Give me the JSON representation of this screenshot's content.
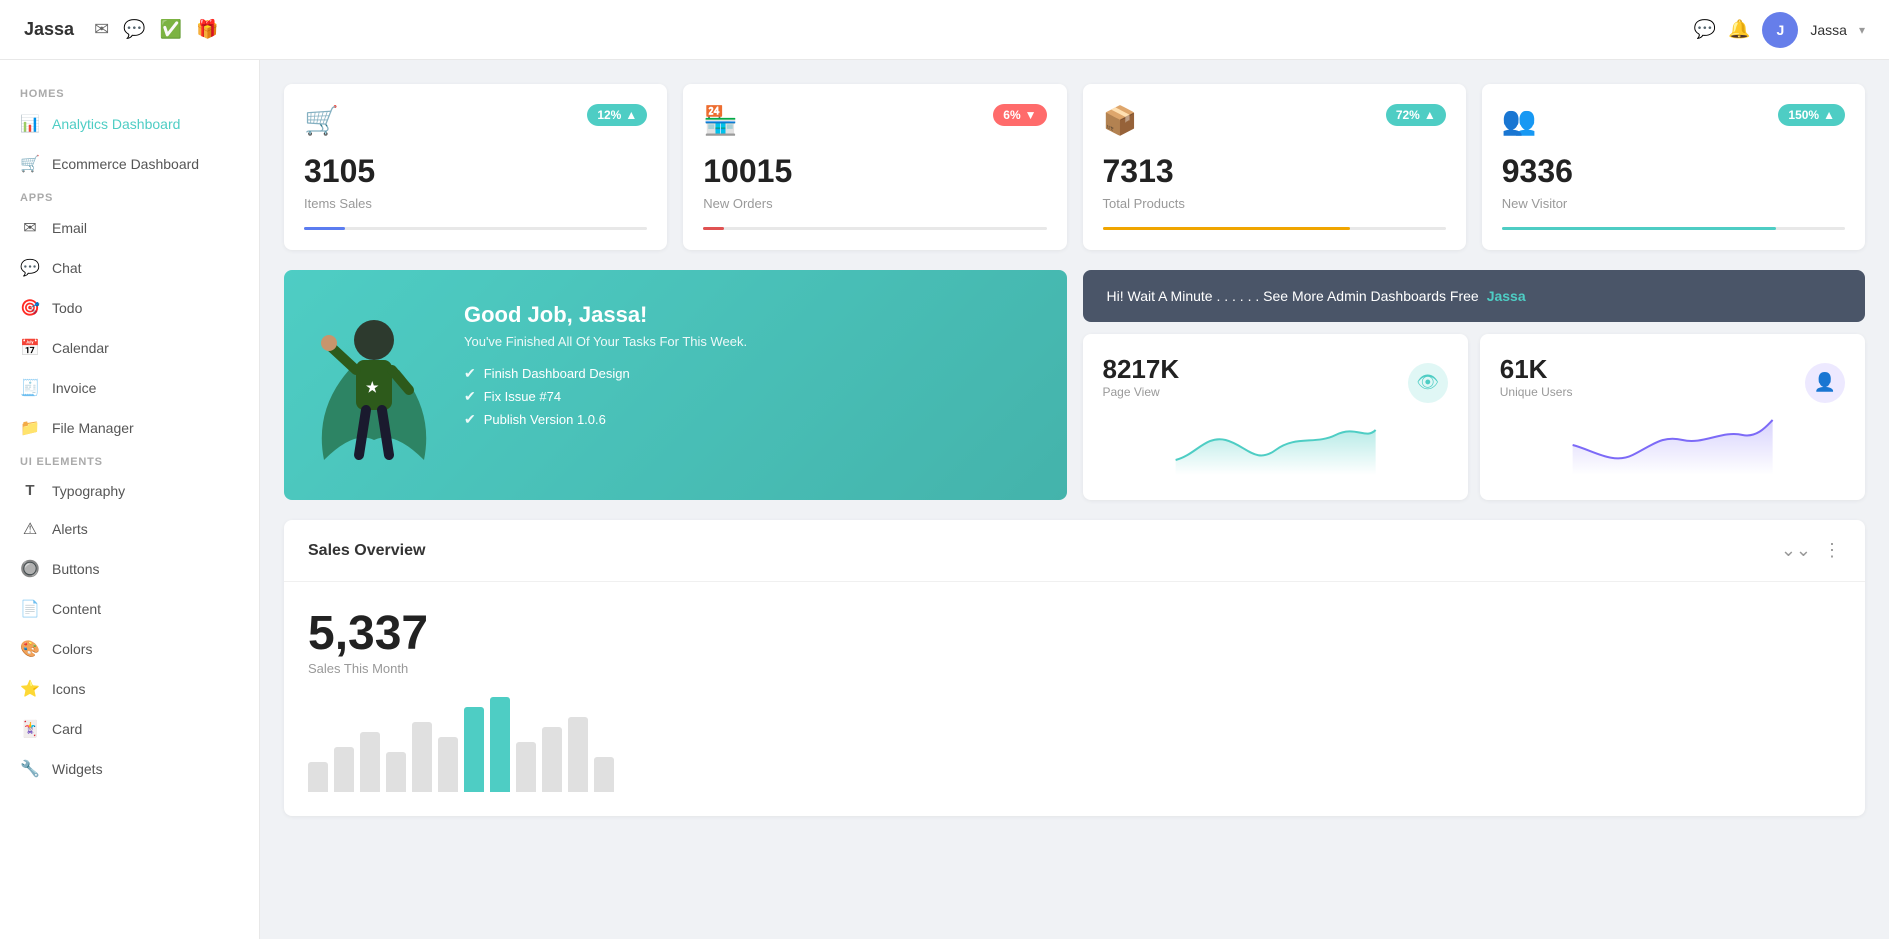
{
  "brand": "Jassa",
  "topnav": {
    "icons": [
      "✉",
      "💬",
      "✅",
      "🎁"
    ],
    "right_icons": [
      "💬",
      "🔔"
    ],
    "user": {
      "name": "Jassa",
      "avatar_initial": "J"
    }
  },
  "sidebar": {
    "sections": [
      {
        "label": "HOMES",
        "items": [
          {
            "id": "analytics-dashboard",
            "label": "Analytics Dashboard",
            "icon": "📊",
            "active": true
          },
          {
            "id": "ecommerce-dashboard",
            "label": "Ecommerce Dashboard",
            "icon": "🛒",
            "active": false
          }
        ]
      },
      {
        "label": "APPS",
        "items": [
          {
            "id": "email",
            "label": "Email",
            "icon": "✉",
            "active": false
          },
          {
            "id": "chat",
            "label": "Chat",
            "icon": "💬",
            "active": false
          },
          {
            "id": "todo",
            "label": "Todo",
            "icon": "🎯",
            "active": false
          },
          {
            "id": "calendar",
            "label": "Calendar",
            "icon": "📅",
            "active": false
          },
          {
            "id": "invoice",
            "label": "Invoice",
            "icon": "🧾",
            "active": false
          },
          {
            "id": "file-manager",
            "label": "File Manager",
            "icon": "📁",
            "active": false
          }
        ]
      },
      {
        "label": "UI ELEMENTS",
        "items": [
          {
            "id": "typography",
            "label": "Typography",
            "icon": "T",
            "active": false
          },
          {
            "id": "alerts",
            "label": "Alerts",
            "icon": "⚠",
            "active": false
          },
          {
            "id": "buttons",
            "label": "Buttons",
            "icon": "🔘",
            "active": false
          },
          {
            "id": "content",
            "label": "Content",
            "icon": "📄",
            "active": false
          },
          {
            "id": "colors",
            "label": "Colors",
            "icon": "🎨",
            "active": false
          },
          {
            "id": "icons",
            "label": "Icons",
            "icon": "⭐",
            "active": false
          },
          {
            "id": "card",
            "label": "Card",
            "icon": "🃏",
            "active": false
          },
          {
            "id": "widgets",
            "label": "Widgets",
            "icon": "🔧",
            "active": false
          }
        ]
      }
    ]
  },
  "stat_cards": [
    {
      "id": "items-sales",
      "icon": "🛒",
      "icon_color": "#5b7cf0",
      "badge_text": "12%",
      "badge_direction": "up",
      "value": "3105",
      "label": "Items Sales",
      "progress": 12,
      "progress_color": "#5b7cf0"
    },
    {
      "id": "new-orders",
      "icon": "🏪",
      "icon_color": "#e05252",
      "badge_text": "6%",
      "badge_direction": "down",
      "value": "10015",
      "label": "New Orders",
      "progress": 6,
      "progress_color": "#e05252"
    },
    {
      "id": "total-products",
      "icon": "📦",
      "icon_color": "#f0a500",
      "badge_text": "72%",
      "badge_direction": "up",
      "value": "7313",
      "label": "Total Products",
      "progress": 72,
      "progress_color": "#f0a500"
    },
    {
      "id": "new-visitor",
      "icon": "👥",
      "icon_color": "#4ecdc4",
      "badge_text": "150%",
      "badge_direction": "up",
      "value": "9336",
      "label": "New Visitor",
      "progress": 80,
      "progress_color": "#4ecdc4"
    }
  ],
  "hero": {
    "title": "Good Job, Jassa!",
    "subtitle": "You've Finished All Of Your Tasks For This Week.",
    "tasks": [
      "Finish Dashboard Design",
      "Fix Issue #74",
      "Publish Version 1.0.6"
    ]
  },
  "announcement": {
    "text": "Hi! Wait A Minute . . . . . . See More Admin Dashboards Free",
    "name": "Jassa"
  },
  "metrics": [
    {
      "id": "page-view",
      "value": "8217K",
      "label": "Page View",
      "icon": "👁",
      "icon_class": "metric-icon-teal"
    },
    {
      "id": "unique-users",
      "value": "61K",
      "label": "Unique Users",
      "icon": "👤",
      "icon_class": "metric-icon-purple"
    }
  ],
  "sales_overview": {
    "title": "Sales Overview",
    "value": "5,337",
    "sub_label": "Sales This Month"
  }
}
